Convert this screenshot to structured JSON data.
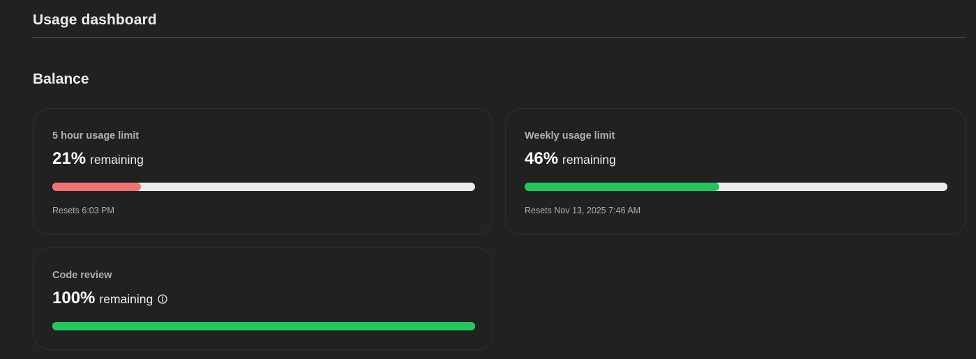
{
  "header": {
    "title": "Usage dashboard"
  },
  "balance": {
    "title": "Balance",
    "cards": [
      {
        "title": "5 hour usage limit",
        "percent": "21%",
        "remaining_label": "remaining",
        "progress_fraction": 0.21,
        "bar_color": "#f47171",
        "reset": "Resets 6:03 PM"
      },
      {
        "title": "Weekly usage limit",
        "percent": "46%",
        "remaining_label": "remaining",
        "progress_fraction": 0.46,
        "bar_color": "#22c55e",
        "reset": "Resets Nov 13, 2025 7:46 AM"
      },
      {
        "title": "Code review",
        "percent": "100%",
        "remaining_label": "remaining",
        "info_icon": "info-circle-icon",
        "progress_fraction": 1.0,
        "bar_color": "#22c55e"
      }
    ]
  },
  "colors": {
    "background": "#212121",
    "track": "#ececec",
    "low": "#f47171",
    "ok": "#22c55e"
  }
}
